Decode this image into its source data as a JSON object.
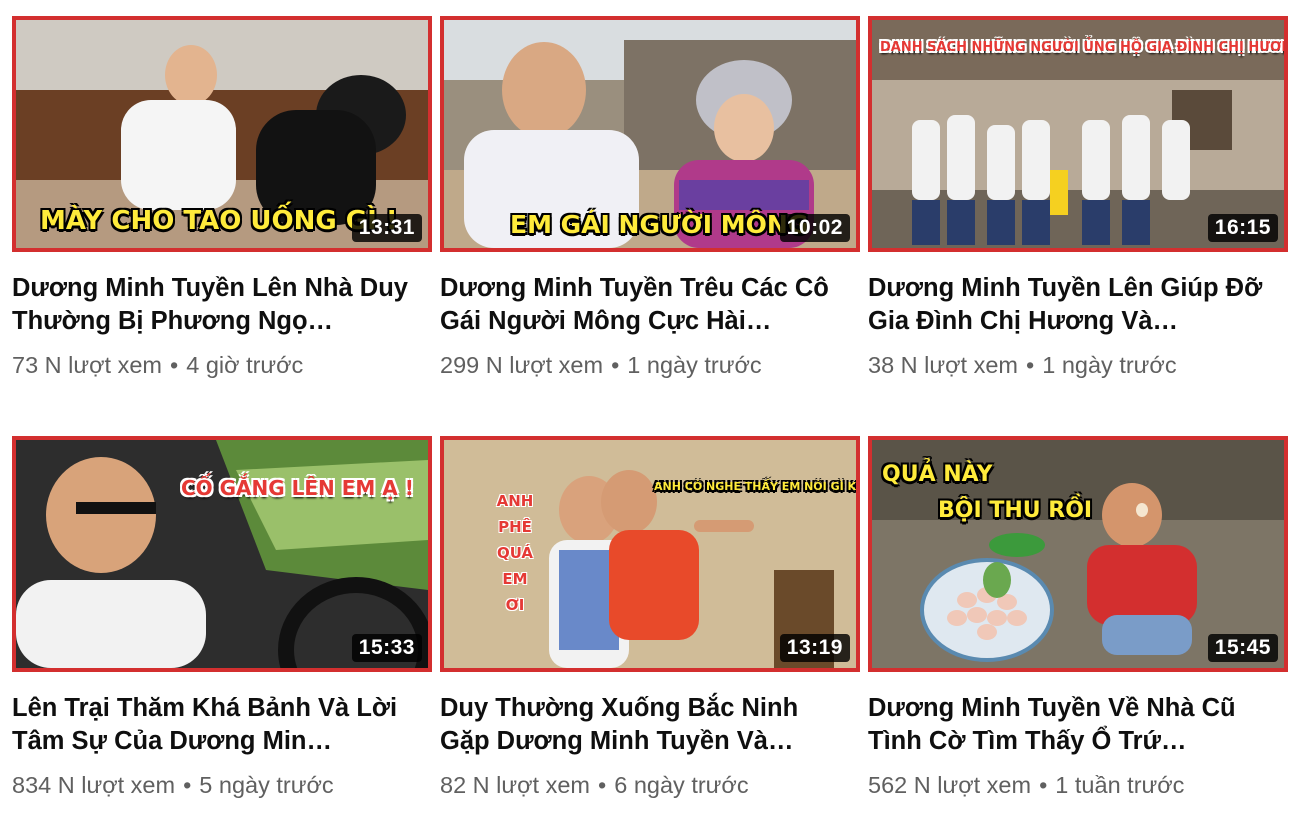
{
  "videos": [
    {
      "caption": "MÀY CHO TAO UỐNG GÌ !",
      "duration": "13:31",
      "title": "Dương Minh Tuyền Lên Nhà Duy Thường Bị Phương Ngọ…",
      "views": "73 N lượt xem",
      "age": "4 giờ trước"
    },
    {
      "caption": "EM GÁI NGƯỜI MÔNG",
      "duration": "10:02",
      "title": "Dương Minh Tuyền Trêu Các Cô Gái Người Mông Cực Hài…",
      "views": "299 N lượt xem",
      "age": "1 ngày trước"
    },
    {
      "caption": "DANH SÁCH NHỮNG NGƯỜI ỦNG HỘ GIA ĐÌNH CHỊ HƯƠNG",
      "duration": "16:15",
      "title": "Dương Minh Tuyền Lên Giúp Đỡ Gia Đình Chị Hương Và…",
      "views": "38 N lượt xem",
      "age": "1 ngày trước"
    },
    {
      "caption": "CỐ GẮNG LÊN EM Ạ !",
      "duration": "15:33",
      "title": "Lên Trại Thăm Khá Bảnh Và Lời Tâm Sự Của Dương Min…",
      "views": "834 N lượt xem",
      "age": "5 ngày trước"
    },
    {
      "caption": "ANH CÓ NGHE THẤY EM NÓI GÌ KHÔNG",
      "side_words": [
        "ANH",
        "PHÊ",
        "QUÁ",
        "EM",
        "ƠI"
      ],
      "duration": "13:19",
      "title": "Duy Thường Xuống Bắc Ninh Gặp Dương Minh Tuyền Và…",
      "views": "82 N lượt xem",
      "age": "6 ngày trước"
    },
    {
      "caption_line1": "QUẢ NÀY",
      "caption_line2": "BỘI THU RỒI",
      "duration": "15:45",
      "title": "Dương Minh Tuyền Về Nhà Cũ Tình Cờ Tìm Thấy Ổ Trứ…",
      "views": "562 N lượt xem",
      "age": "1 tuần trước"
    }
  ],
  "separator": "•",
  "colors": {
    "thumb_border": "#d32f2f",
    "caption_yellow": "#ffeb3b",
    "caption_red": "#e53935"
  }
}
